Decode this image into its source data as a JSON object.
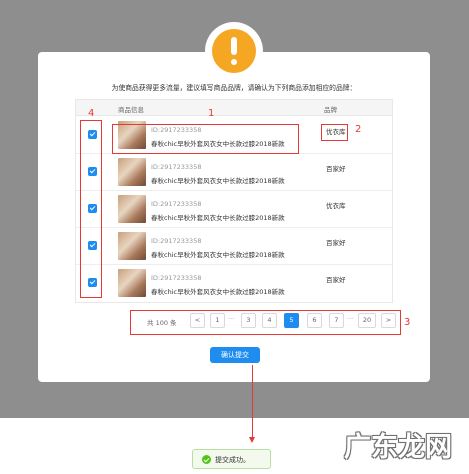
{
  "dialog": {
    "message": "为使商品获得更多流量，建议填写商品品牌，请确认为下列商品添加相应的品牌：",
    "submit_label": "确认提交"
  },
  "table": {
    "col_info": "商品信息",
    "col_brand": "品牌",
    "rows": [
      {
        "id": "ID:2917233358",
        "name": "春秋chic早秋外套风衣女中长款过膝2018新款",
        "brand": "优衣库",
        "checked": true
      },
      {
        "id": "ID:2917233358",
        "name": "春秋chic早秋外套风衣女中长款过膝2018新款",
        "brand": "百家好",
        "checked": true
      },
      {
        "id": "ID:2917233358",
        "name": "春秋chic早秋外套风衣女中长款过膝2018新款",
        "brand": "优衣库",
        "checked": true
      },
      {
        "id": "ID:2917233358",
        "name": "春秋chic早秋外套风衣女中长款过膝2018新款",
        "brand": "百家好",
        "checked": true
      },
      {
        "id": "ID:2917233358",
        "name": "春秋chic早秋外套风衣女中长款过膝2018新款",
        "brand": "百家好",
        "checked": true
      }
    ]
  },
  "pagination": {
    "total": "共 100 条",
    "prev": "<",
    "next": ">",
    "pages": [
      "1",
      "3",
      "4",
      "5",
      "6",
      "7",
      "20"
    ],
    "dots": "···",
    "current": "5"
  },
  "annotations": {
    "a1": "1",
    "a2": "2",
    "a3": "3",
    "a4": "4"
  },
  "toast": {
    "text": "提交成功。"
  },
  "watermark": "广东龙网",
  "colors": {
    "primary": "#1f8cf0",
    "warning": "#f5a623",
    "annotation": "#e53935",
    "success": "#52c41a"
  }
}
